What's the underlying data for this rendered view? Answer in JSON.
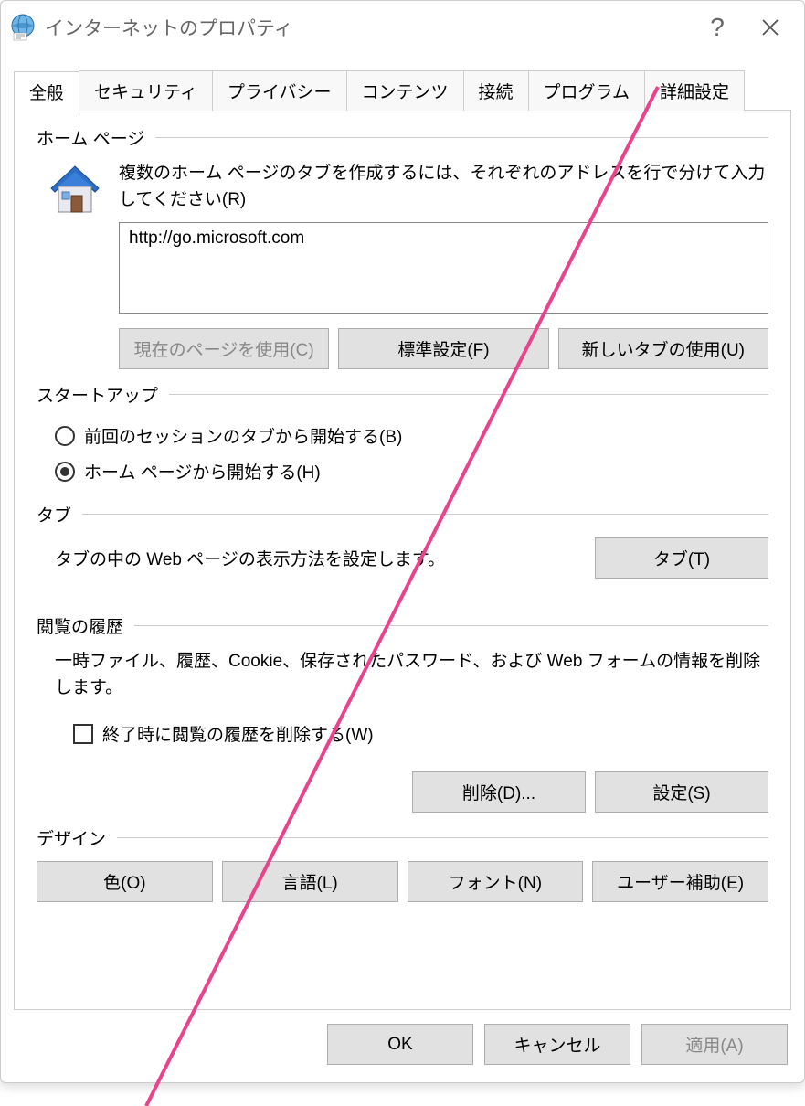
{
  "window": {
    "title": "インターネットのプロパティ"
  },
  "tabs": {
    "general": "全般",
    "security": "セキュリティ",
    "privacy": "プライバシー",
    "content": "コンテンツ",
    "connections": "接続",
    "programs": "プログラム",
    "advanced": "詳細設定"
  },
  "home": {
    "group_label": "ホーム ページ",
    "hint": "複数のホーム ページのタブを作成するには、それぞれのアドレスを行で分けて入力してください(R)",
    "value": "http://go.microsoft.com",
    "use_current": "現在のページを使用(C)",
    "use_default": "標準設定(F)",
    "use_newtab": "新しいタブの使用(U)"
  },
  "startup": {
    "group_label": "スタートアップ",
    "option_last": "前回のセッションのタブから開始する(B)",
    "option_home": "ホーム ページから開始する(H)"
  },
  "tabs_section": {
    "group_label": "タブ",
    "text": "タブの中の Web ページの表示方法を設定します。",
    "button": "タブ(T)"
  },
  "history": {
    "group_label": "閲覧の履歴",
    "text": "一時ファイル、履歴、Cookie、保存されたパスワード、および Web フォームの情報を削除します。",
    "check_label": "終了時に閲覧の履歴を削除する(W)",
    "delete": "削除(D)...",
    "settings": "設定(S)"
  },
  "design": {
    "group_label": "デザイン",
    "colors": "色(O)",
    "languages": "言語(L)",
    "fonts": "フォント(N)",
    "accessibility": "ユーザー補助(E)"
  },
  "footer": {
    "ok": "OK",
    "cancel": "キャンセル",
    "apply": "適用(A)"
  }
}
